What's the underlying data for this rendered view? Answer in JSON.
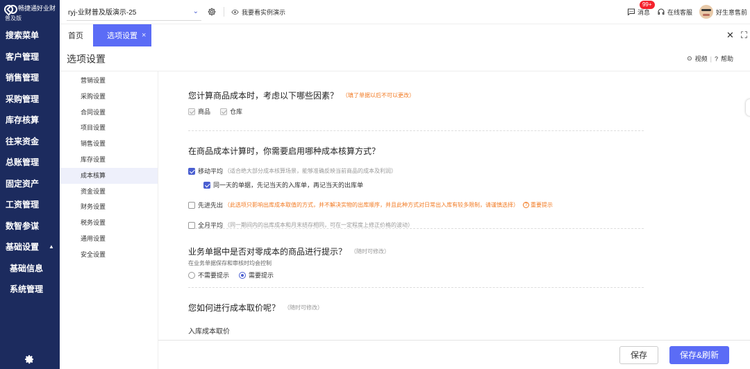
{
  "app": {
    "logo_name": "畅捷通好业财",
    "logo_sub": "普及版"
  },
  "sidebar": {
    "items": [
      {
        "label": "搜索菜单"
      },
      {
        "label": "客户管理"
      },
      {
        "label": "销售管理"
      },
      {
        "label": "采购管理"
      },
      {
        "label": "库存核算"
      },
      {
        "label": "往来资金"
      },
      {
        "label": "总账管理"
      },
      {
        "label": "固定资产"
      },
      {
        "label": "工资管理"
      },
      {
        "label": "数智参谋"
      },
      {
        "label": "基础设置",
        "expanded": true
      },
      {
        "label": "基础信息"
      },
      {
        "label": "系统管理"
      }
    ]
  },
  "topbar": {
    "account": "ryj-业财普及版演示-25",
    "demo_link": "我要看实例演示",
    "messages_label": "消息",
    "messages_badge": "99+",
    "support_label": "在线客服",
    "user_name": "好生意售前"
  },
  "tabs": [
    {
      "label": "首页",
      "active": false
    },
    {
      "label": "选项设置",
      "active": true
    }
  ],
  "page": {
    "title": "选项设置",
    "video_label": "视频",
    "help_label": "帮助"
  },
  "sub_nav": [
    {
      "label": "营销设置"
    },
    {
      "label": "采购设置"
    },
    {
      "label": "合同设置"
    },
    {
      "label": "项目设置"
    },
    {
      "label": "销售设置"
    },
    {
      "label": "库存设置"
    },
    {
      "label": "成本核算",
      "active": true
    },
    {
      "label": "资金设置"
    },
    {
      "label": "财务设置"
    },
    {
      "label": "税务设置"
    },
    {
      "label": "通用设置"
    },
    {
      "label": "安全设置"
    }
  ],
  "settings": {
    "s1": {
      "question": "您计算商品成本时，考虑以下哪些因素？",
      "hint": "（填了单据以后不可以更改）",
      "opt1": "商品",
      "opt2": "仓库"
    },
    "s2": {
      "question": "在商品成本计算时，你需要启用哪种成本核算方式？",
      "moving_avg": "移动平均",
      "moving_avg_note": "（适合绝大部分成本核算场景，能够准确反映当前商品的成本及利润）",
      "same_day": "同一天的单据，先记当天的入库单，再记当天的出库单",
      "fifo": "先进先出",
      "fifo_note": "（此选项只影响出库成本取值的方式，并不解决实物的出库顺序，并且此种方式对日常出入库有较多限制，请谨慎选择）",
      "fifo_important": "重要提示",
      "monthly_avg": "全月平均",
      "monthly_avg_note": "（同一期间内的出库成本和月末结存相同，可在一定程度上修正价格的波动）"
    },
    "s3": {
      "question": "业务单据中是否对零成本的商品进行提示？",
      "hint": "（随时可修改）",
      "desc": "在业务单据保存和审核时均会控制",
      "no_prompt": "不需要提示",
      "need_prompt": "需要提示"
    },
    "s4": {
      "question": "您如何进行成本取价呢？",
      "hint": "（随时可修改）",
      "sub_label": "入库成本取价"
    }
  },
  "footer": {
    "save": "保存",
    "save_refresh": "保存&刷新"
  },
  "colors": {
    "sidebar_bg": "#1c2b5e",
    "accent": "#5b6cf6",
    "warn": "#f27a22",
    "badge": "#f5222d"
  }
}
